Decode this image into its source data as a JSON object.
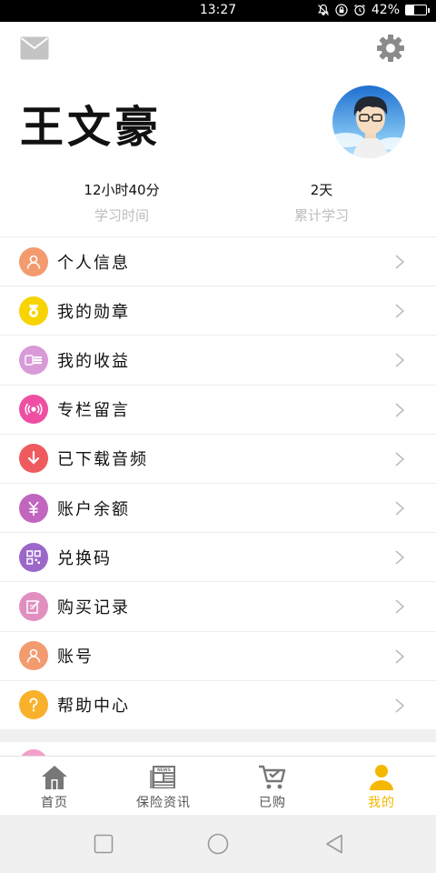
{
  "status_bar": {
    "time": "13:27",
    "battery_text": "42%",
    "battery_level": 0.42
  },
  "profile": {
    "name": "王文豪"
  },
  "stats": [
    {
      "value": "12小时40分",
      "label": "学习时间"
    },
    {
      "value": "2天",
      "label": "累计学习"
    }
  ],
  "menu": [
    {
      "label": "个人信息",
      "icon": "person-icon",
      "color": "#f39a6f"
    },
    {
      "label": "我的勋章",
      "icon": "medal-icon",
      "color": "#f7d300"
    },
    {
      "label": "我的收益",
      "icon": "coins-icon",
      "color": "#d99ad8"
    },
    {
      "label": "专栏留言",
      "icon": "broadcast-icon",
      "color": "#ee4fa3"
    },
    {
      "label": "已下载音频",
      "icon": "download-icon",
      "color": "#ef5a5f"
    },
    {
      "label": "账户余额",
      "icon": "yuan-icon",
      "color": "#c066bf"
    },
    {
      "label": "兑换码",
      "icon": "qrcode-icon",
      "color": "#9b67c9"
    },
    {
      "label": "购买记录",
      "icon": "edit-record-icon",
      "color": "#e08fbf"
    },
    {
      "label": "账号",
      "icon": "account-icon",
      "color": "#f39a6f"
    },
    {
      "label": "帮助中心",
      "icon": "question-icon",
      "color": "#f9b12c"
    }
  ],
  "bottom_nav": [
    {
      "label": "首页",
      "icon": "home-icon"
    },
    {
      "label": "保险资讯",
      "icon": "news-icon"
    },
    {
      "label": "已购",
      "icon": "cart-icon"
    },
    {
      "label": "我的",
      "icon": "user-icon",
      "active": true
    }
  ],
  "colors": {
    "accent": "#f5b800",
    "divider": "#ececec"
  }
}
